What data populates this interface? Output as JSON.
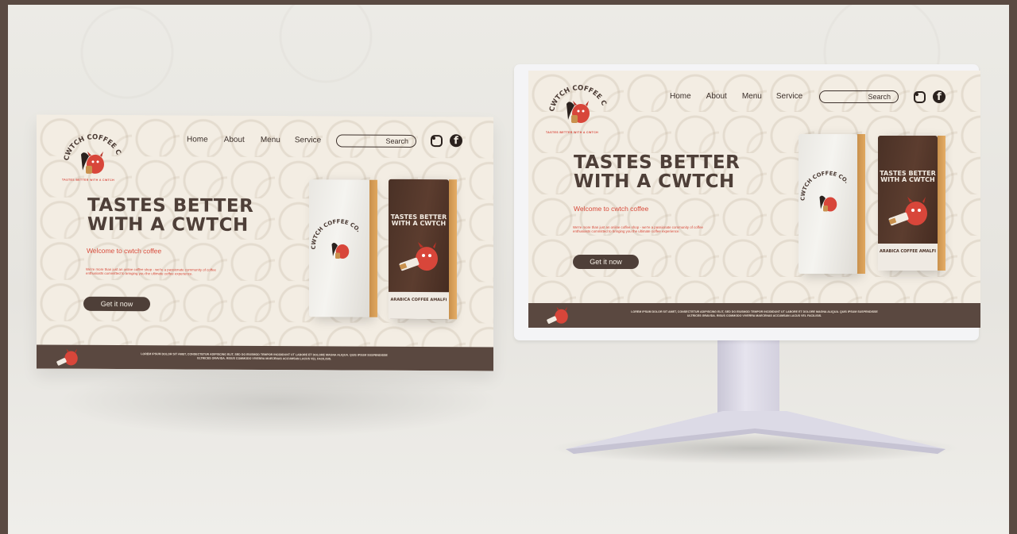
{
  "colors": {
    "backdrop": "#5a4a42",
    "panel_cream": "#f3ede3",
    "espresso": "#4e3f38",
    "accent_red": "#d84a3a",
    "footer": "#5a4840"
  },
  "brand": {
    "name": "CWTCH COFFEE CO.",
    "tagline": "TASTES BETTER WITH A CWTCH"
  },
  "nav": {
    "items": [
      "Home",
      "About",
      "Menu",
      "Service"
    ],
    "search_label": "Search"
  },
  "social": {
    "icons": [
      "instagram-icon",
      "facebook-icon"
    ]
  },
  "hero": {
    "headline_line1": "TASTES BETTER",
    "headline_line2": "WITH A CWTCH",
    "welcome": "Welcome to cwtch coffee",
    "intro": "We're more than just an online coffee shop - we're  a passionate community of coffee enthusiasts committed to bringing you the ultimate coffee experience.",
    "cta_label": "Get it now"
  },
  "product": {
    "white_bag_brand": "CWTCH COFFEE CO.",
    "brown_bag_title_line1": "TASTES BETTER",
    "brown_bag_title_line2": "WITH A CWTCH",
    "brown_bag_label": "ARABICA COFFEE AMALFI"
  },
  "footer": {
    "text_line1": "Lorem ipsum dolor sit amet, consectetur adipiscing elit, sed do eiusmod tempor incididunt ut labore et dolore magna aliqua. Quis ipsum suspendisse",
    "text_line2": "ultrices gravida. Risus commodo viverra maecenas accumsan lacus vel facilisis."
  }
}
